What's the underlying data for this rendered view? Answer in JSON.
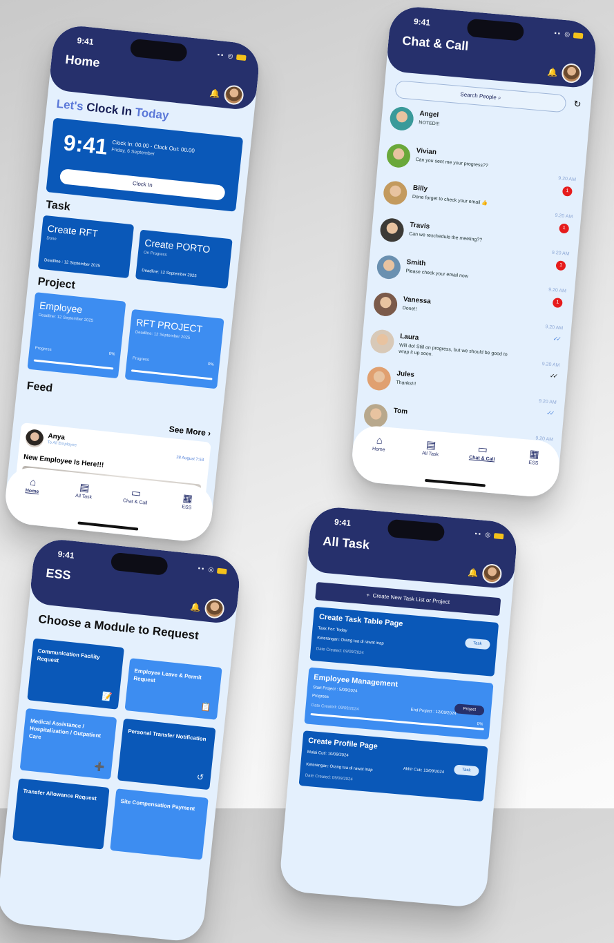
{
  "status_bar": {
    "time": "9:41"
  },
  "tabs": {
    "home": "Home",
    "all_task": "All Task",
    "chat": "Chat & Call",
    "ess": "ESS"
  },
  "home": {
    "title": "Home",
    "clock_title_a": "Let's",
    "clock_title_b": "Clock In",
    "clock_title_c": "Today",
    "clock_time": "9:41",
    "clock_info": "Clock In: 00.00   -   Clock Out: 00.00",
    "clock_date": "Friday, 6 September",
    "clock_btn": "Clock In",
    "task_header": "Task",
    "tasks": [
      {
        "title": "Create RFT",
        "status": "Done",
        "deadline": "Deadline : 12 September 2025"
      },
      {
        "title": "Create PORTO",
        "status": "On Progress",
        "deadline": "Deadline: 12 September 2025"
      }
    ],
    "project_header": "Project",
    "projects": [
      {
        "title": "Employee",
        "deadline": "Deadline: 12 September 2025",
        "progress_label": "Progress",
        "progress": "0%"
      },
      {
        "title": "RFT PROJECT",
        "deadline": "Deadline: 12 September 2025",
        "progress_label": "Progress",
        "progress": "0%"
      }
    ],
    "feed_header": "Feed",
    "see_more": "See More",
    "feed": {
      "name": "Anya",
      "to": "To All Employee",
      "date": "28 August 7:53",
      "text": "New Employee Is Here!!!"
    }
  },
  "chat": {
    "title": "Chat & Call",
    "search_placeholder": "Search People",
    "rows": [
      {
        "name": "Angel",
        "msg": "NOTED!!!",
        "time": "",
        "badge": "",
        "check": "",
        "color": "#3a9a9a"
      },
      {
        "name": "Vivian",
        "msg": "Can you sent me your progress??",
        "time": "9.20 AM",
        "badge": "1",
        "check": "",
        "color": "#6aa83a"
      },
      {
        "name": "Billy",
        "msg": "Done forget to check your email 👍",
        "time": "9.20 AM",
        "badge": "1",
        "check": "",
        "color": "#c39a5e"
      },
      {
        "name": "Travis",
        "msg": "Can we reschedule the meeting??",
        "time": "9.20 AM",
        "badge": "1",
        "check": "",
        "color": "#3c3a36"
      },
      {
        "name": "Smith",
        "msg": "Please check your email now",
        "time": "9.20 AM",
        "badge": "1",
        "check": "",
        "color": "#6a90b0"
      },
      {
        "name": "Vanessa",
        "msg": "Done!!",
        "time": "9.20 AM",
        "badge": "",
        "check": "✓✓",
        "color": "#7b5a4a"
      },
      {
        "name": "Laura",
        "msg": "Will do! Still on progress, but we should be good to wrap it up soon.",
        "time": "9.20 AM",
        "badge": "",
        "check": "✓✓",
        "color": "#d8c9b8"
      },
      {
        "name": "Jules",
        "msg": "Thanks!!!",
        "time": "9.20 AM",
        "badge": "",
        "check": "✓✓",
        "color": "#e0a070"
      },
      {
        "name": "Tom",
        "msg": "",
        "time": "9.20 AM",
        "badge": "1",
        "check": "",
        "color": "#b8a88c"
      }
    ],
    "last_time": "9.20 AM"
  },
  "ess": {
    "title": "ESS",
    "heading": "Choose a Module to Request",
    "modules": [
      {
        "title": "Communication Facility Request",
        "icon": "📝"
      },
      {
        "title": "Employee Leave & Permit Request",
        "icon": "📋"
      },
      {
        "title": "Medical Assistance / Hospitalization / Outpatient Care",
        "icon": "➕"
      },
      {
        "title": "Personal Transfer Notification",
        "icon": "↺"
      },
      {
        "title": "Transfer Allowance Request",
        "icon": ""
      },
      {
        "title": "Site Compensation Payment",
        "icon": ""
      }
    ]
  },
  "all_task": {
    "title": "All Task",
    "create_btn": "Create New Task List or Project",
    "cards": [
      {
        "title": "Create Task Table Page",
        "l1": "Task For: Today",
        "l2": "Keterangan: Orang tua di rawat inap",
        "date": "Date Created: 09/09/2024",
        "pill": "Task"
      },
      {
        "title": "Employee Management",
        "l1": "Start Project : 5/09/2024",
        "r1": "End Project : 12/09/2024",
        "prog_label": "Progress",
        "prog": "0%",
        "date": "Date Created: 09/09/2024",
        "pill": "Project"
      },
      {
        "title": "Create Profile Page",
        "l1": "Mulai Cuti: 10/09/2024",
        "r1": "Akhir Cuti: 13/09/2024",
        "l2": "Keterangan: Orang tua di rawat inap",
        "date": "Date Created: 09/09/2024",
        "pill": "Task"
      }
    ]
  }
}
